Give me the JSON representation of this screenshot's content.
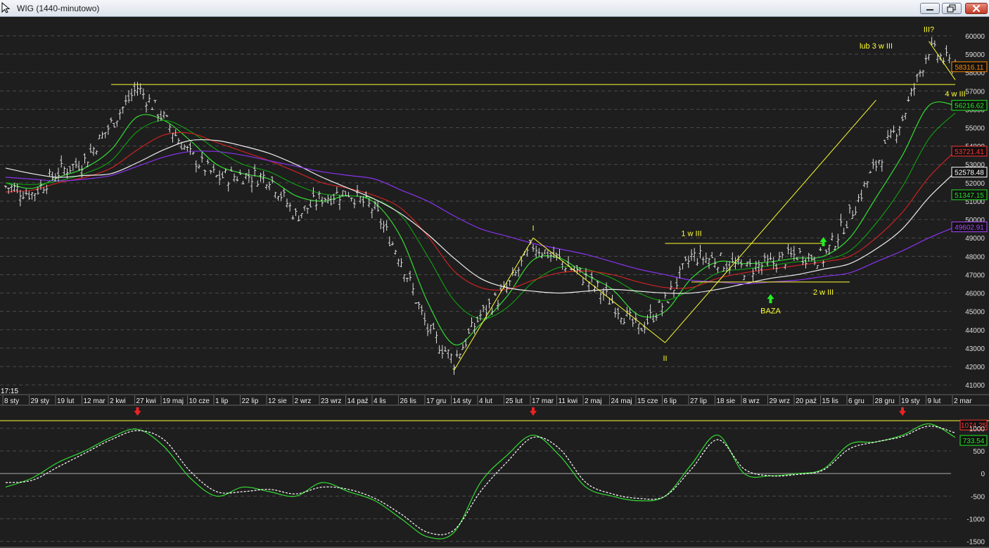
{
  "window": {
    "title": "WIG (1440-minutowo)",
    "minimize_icon": "minimize-icon",
    "maximize_icon": "restore-icon",
    "close_icon": "close-icon"
  },
  "colors": {
    "background": "#1e1e1e",
    "grid": "#4a4a4a",
    "price_bars": "#dddddd",
    "annotation": "#ffff33",
    "ma_green_fast": "#33dd33",
    "ma_green_mid": "#119911",
    "ma_red": "#cc2222",
    "ma_white": "#eeeeee",
    "ma_violet": "#8833ee",
    "signal_arrow_up": "#22ee22",
    "signal_arrow_down": "#ee2222",
    "oscillator_line": "#33dd33",
    "oscillator_signal": "#ffffff"
  },
  "time_label": "17:15",
  "chart_data": [
    {
      "type": "line",
      "panel": "price",
      "y_ticks": [
        41000,
        42000,
        43000,
        44000,
        45000,
        46000,
        47000,
        48000,
        49000,
        50000,
        51000,
        52000,
        53000,
        54000,
        55000,
        56000,
        57000,
        58000,
        59000,
        60000
      ],
      "ylim": [
        40700,
        60800
      ],
      "grid": true,
      "x_labels": [
        "8 sty",
        "29 sty",
        "19 lut",
        "12 mar",
        "2 kwi",
        "27 kwi",
        "19 maj",
        "10 cze",
        "1 lip",
        "22 lip",
        "12 sie",
        "2 wrz",
        "23 wrz",
        "14 paź",
        "4 lis",
        "26 lis",
        "17 gru",
        "14 sty",
        "4 lut",
        "25 lut",
        "17 mar",
        "11 kwi",
        "2 maj",
        "24 maj",
        "15 cze",
        "6 lip",
        "27 lip",
        "18 sie",
        "8 wrz",
        "29 wrz",
        "20 paź",
        "15 lis",
        "6 gru",
        "28 gru",
        "19 sty",
        "9 lut",
        "2 mar"
      ],
      "price_close": [
        {
          "label": "8 sty",
          "value": 51800
        },
        {
          "label": "29 sty",
          "value": 51400
        },
        {
          "label": "19 lut",
          "value": 52600
        },
        {
          "label": "12 mar",
          "value": 53200
        },
        {
          "label": "2 kwi",
          "value": 55200
        },
        {
          "label": "27 kwi",
          "value": 57200
        },
        {
          "label": "19 maj",
          "value": 55500
        },
        {
          "label": "10 cze",
          "value": 53500
        },
        {
          "label": "1 lip",
          "value": 52300
        },
        {
          "label": "22 lip",
          "value": 52400
        },
        {
          "label": "12 sie",
          "value": 52300
        },
        {
          "label": "2 wrz",
          "value": 50200
        },
        {
          "label": "23 wrz",
          "value": 51200
        },
        {
          "label": "14 paź",
          "value": 51500
        },
        {
          "label": "4 lis",
          "value": 50500
        },
        {
          "label": "26 lis",
          "value": 47800
        },
        {
          "label": "17 gru",
          "value": 44000
        },
        {
          "label": "14 sty",
          "value": 42300
        },
        {
          "label": "4 lut",
          "value": 44800
        },
        {
          "label": "25 lut",
          "value": 46200
        },
        {
          "label": "17 mar",
          "value": 48600
        },
        {
          "label": "11 kwi",
          "value": 47800
        },
        {
          "label": "2 maj",
          "value": 46800
        },
        {
          "label": "24 maj",
          "value": 45500
        },
        {
          "label": "15 cze",
          "value": 44000
        },
        {
          "label": "6 lip",
          "value": 45500
        },
        {
          "label": "27 lip",
          "value": 48000
        },
        {
          "label": "18 sie",
          "value": 47800
        },
        {
          "label": "8 wrz",
          "value": 47300
        },
        {
          "label": "29 wrz",
          "value": 47600
        },
        {
          "label": "20 paź",
          "value": 48100
        },
        {
          "label": "15 lis",
          "value": 47900
        },
        {
          "label": "6 gru",
          "value": 50200
        },
        {
          "label": "28 gru",
          "value": 53000
        },
        {
          "label": "19 sty",
          "value": 55500
        },
        {
          "label": "9 lut",
          "value": 59300
        },
        {
          "label": "2 mar",
          "value": 58316
        }
      ],
      "series": [
        {
          "color_key": "ma_green_fast",
          "values": [
            52000,
            51700,
            52300,
            52800,
            53800,
            55600,
            55400,
            54300,
            53000,
            52500,
            52200,
            51300,
            51000,
            51300,
            50900,
            49000,
            45500,
            43200,
            44300,
            45800,
            47800,
            47900,
            47000,
            46200,
            44800,
            45000,
            46800,
            47700,
            47600,
            47700,
            47900,
            48000,
            49000,
            51200,
            53500,
            56200,
            56217
          ]
        },
        {
          "color_key": "ma_green_mid",
          "values": [
            52000,
            51900,
            52100,
            52500,
            53200,
            54800,
            55400,
            54800,
            53800,
            53000,
            52600,
            51900,
            51400,
            51300,
            51100,
            50200,
            48000,
            45600,
            44600,
            45200,
            46600,
            47400,
            47300,
            46800,
            46000,
            45600,
            46200,
            47100,
            47300,
            47500,
            47700,
            47800,
            48300,
            49800,
            51800,
            54400,
            55800
          ]
        },
        {
          "color_key": "ma_red",
          "values": [
            51500,
            51600,
            52000,
            52300,
            52800,
            53800,
            54600,
            54700,
            54200,
            53700,
            53200,
            52600,
            52000,
            51700,
            51300,
            50600,
            49100,
            47200,
            46300,
            46200,
            46700,
            47100,
            47200,
            47000,
            46600,
            46300,
            46300,
            46800,
            47100,
            47300,
            47500,
            47700,
            48000,
            49000,
            50400,
            52300,
            53721
          ]
        },
        {
          "color_key": "ma_white",
          "values": [
            52800,
            52500,
            52300,
            52400,
            52500,
            53100,
            53800,
            54300,
            54300,
            54000,
            53600,
            53000,
            52300,
            51700,
            51100,
            50300,
            49200,
            47900,
            46800,
            46300,
            46100,
            46000,
            46100,
            46200,
            46100,
            46000,
            46000,
            46200,
            46500,
            46800,
            47000,
            47300,
            47600,
            48400,
            49500,
            51200,
            52578
          ]
        },
        {
          "color_key": "ma_violet",
          "values": [
            52300,
            52200,
            52100,
            52200,
            52400,
            52900,
            53400,
            53700,
            53700,
            53500,
            53200,
            52900,
            52600,
            52400,
            52200,
            51600,
            51000,
            50200,
            49500,
            49100,
            48700,
            48400,
            48100,
            47700,
            47300,
            47000,
            46700,
            46600,
            46500,
            46600,
            46700,
            46900,
            47100,
            47700,
            48300,
            49000,
            49603
          ]
        }
      ],
      "price_labels": [
        {
          "value": 58316.11,
          "color": "#ff8800",
          "text": "58316.11"
        },
        {
          "value": 56216.62,
          "color": "#22ee22",
          "text": "56216.62"
        },
        {
          "value": 53721.41,
          "color": "#ff3333",
          "text": "53721.41"
        },
        {
          "value": 52578.48,
          "color": "#ffffff",
          "text": "52578.48"
        },
        {
          "value": 51347.15,
          "color": "#22dd22",
          "text": "51347.15"
        },
        {
          "value": 49602.91,
          "color": "#aa44ff",
          "text": "49602.91"
        }
      ],
      "annotations": [
        {
          "text": "I",
          "label": "17 mar",
          "value": 49400
        },
        {
          "text": "II",
          "label": "6 lip",
          "value": 42300
        },
        {
          "text": "1 w III",
          "label": "27 lip",
          "value": 49100
        },
        {
          "text": "BAZA",
          "label": "29 wrz",
          "value": 44900
        },
        {
          "text": "2 w III",
          "label": "15 lis",
          "value": 45900
        },
        {
          "text": "III?",
          "label": "9 lut",
          "value": 60200
        },
        {
          "text": "lub 3 w III",
          "label": "28 gru",
          "value": 59300
        },
        {
          "text": "4 w III",
          "label": "2 mar",
          "value": 56700
        }
      ],
      "signals": [
        {
          "type": "up",
          "label": "29 wrz",
          "value": 45600
        },
        {
          "type": "up",
          "label": "15 lis",
          "value": 48700
        }
      ]
    },
    {
      "type": "line",
      "panel": "oscillator",
      "y_ticks": [
        -1500,
        -1000,
        -500,
        0,
        500,
        1000
      ],
      "ylim": [
        -1600,
        1450
      ],
      "grid": true,
      "series": [
        {
          "color_key": "oscillator_line",
          "values": [
            -300,
            -100,
            250,
            500,
            800,
            980,
            600,
            -100,
            -500,
            -300,
            -400,
            -500,
            -200,
            -400,
            -600,
            -1000,
            -1400,
            -1300,
            -200,
            400,
            850,
            400,
            -300,
            -500,
            -600,
            -500,
            200,
            850,
            0,
            -50,
            0,
            100,
            650,
            700,
            850,
            1100,
            800
          ]
        },
        {
          "color_key": "oscillator_signal",
          "values": [
            -200,
            -150,
            150,
            450,
            750,
            950,
            750,
            50,
            -400,
            -400,
            -350,
            -450,
            -300,
            -350,
            -550,
            -900,
            -1300,
            -1250,
            -400,
            250,
            800,
            550,
            -200,
            -450,
            -550,
            -500,
            100,
            750,
            100,
            -50,
            -20,
            80,
            550,
            700,
            820,
            1050,
            900
          ]
        }
      ],
      "value_labels": [
        {
          "value": 1074.25,
          "color": "#ff3333",
          "text": "1074.25"
        },
        {
          "value": 733.54,
          "color": "#22ee22",
          "text": "733.54"
        }
      ],
      "signals": [
        {
          "type": "down",
          "label": "27 kwi"
        },
        {
          "type": "down",
          "label": "17 mar"
        },
        {
          "type": "down",
          "label": "19 sty"
        }
      ]
    }
  ]
}
